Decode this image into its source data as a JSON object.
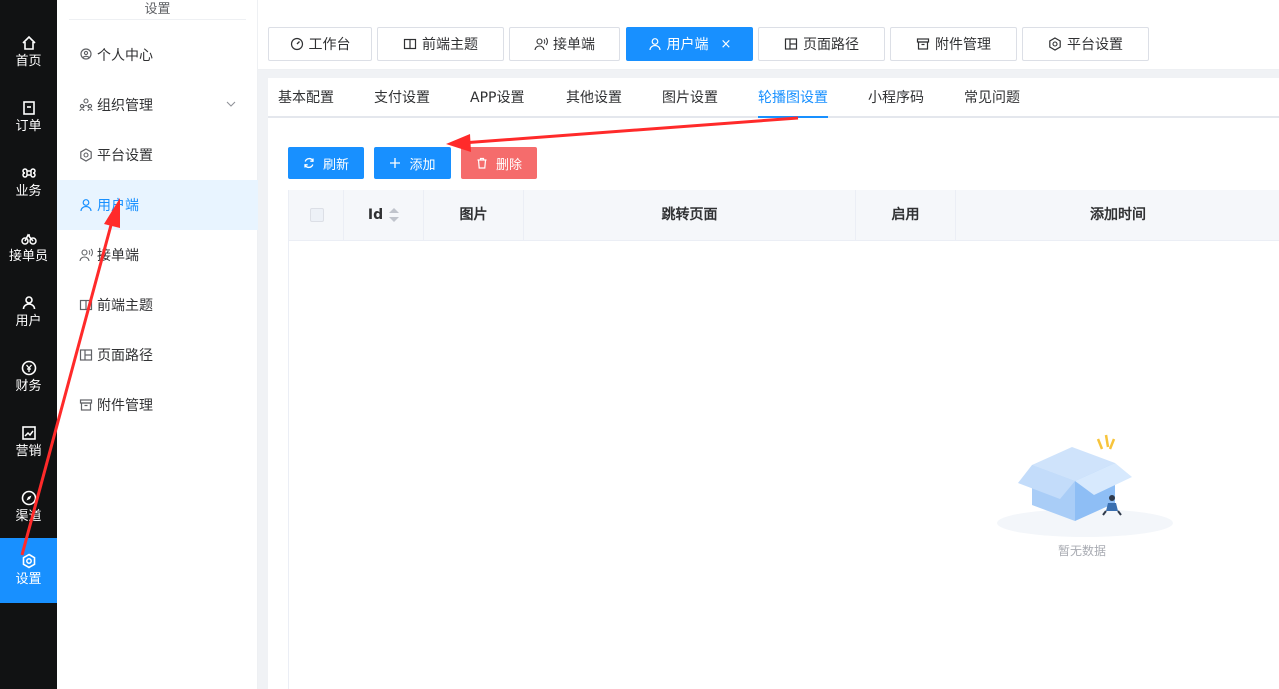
{
  "rail": {
    "items": [
      {
        "label": "首页",
        "icon": "home-icon"
      },
      {
        "label": "订单",
        "icon": "order-icon"
      },
      {
        "label": "业务",
        "icon": "command-icon"
      },
      {
        "label": "接单员",
        "icon": "bicycle-icon"
      },
      {
        "label": "用户",
        "icon": "user-icon"
      },
      {
        "label": "财务",
        "icon": "yen-icon"
      },
      {
        "label": "营销",
        "icon": "chart-icon"
      },
      {
        "label": "渠道",
        "icon": "compass-icon"
      },
      {
        "label": "设置",
        "icon": "gear-icon",
        "active": true
      }
    ]
  },
  "sidebar": {
    "title": "设置",
    "items": [
      {
        "label": "个人中心",
        "icon": "location-icon"
      },
      {
        "label": "组织管理",
        "icon": "org-icon",
        "expandable": true
      },
      {
        "label": "平台设置",
        "icon": "hexagon-icon"
      },
      {
        "label": "用户端",
        "icon": "user-icon",
        "active": true
      },
      {
        "label": "接单端",
        "icon": "user-voice-icon"
      },
      {
        "label": "前端主题",
        "icon": "book-icon"
      },
      {
        "label": "页面路径",
        "icon": "layout-icon"
      },
      {
        "label": "附件管理",
        "icon": "archive-icon"
      }
    ]
  },
  "toptabs": {
    "items": [
      {
        "label": "工作台",
        "icon": "dashboard-icon"
      },
      {
        "label": "前端主题",
        "icon": "book-icon"
      },
      {
        "label": "接单端",
        "icon": "user-voice-icon"
      },
      {
        "label": "用户端",
        "icon": "user-icon",
        "active": true,
        "close": "×"
      },
      {
        "label": "页面路径",
        "icon": "layout-icon"
      },
      {
        "label": "附件管理",
        "icon": "archive-icon"
      },
      {
        "label": "平台设置",
        "icon": "hexagon-icon"
      }
    ]
  },
  "subtabs": {
    "items": [
      "基本配置",
      "支付设置",
      "APP设置",
      "其他设置",
      "图片设置",
      "轮播图设置",
      "小程序码",
      "常见问题"
    ],
    "active": "轮播图设置"
  },
  "toolbar": {
    "refresh_label": "刷新",
    "add_label": "添加",
    "delete_label": "删除"
  },
  "table": {
    "columns": [
      "Id",
      "图片",
      "跳转页面",
      "启用",
      "添加时间"
    ],
    "empty_text": "暂无数据"
  },
  "colors": {
    "primary": "#1890ff",
    "danger": "#f56c6c",
    "rail_bg": "#111213",
    "annotation_arrow": "#ff2a2a"
  }
}
